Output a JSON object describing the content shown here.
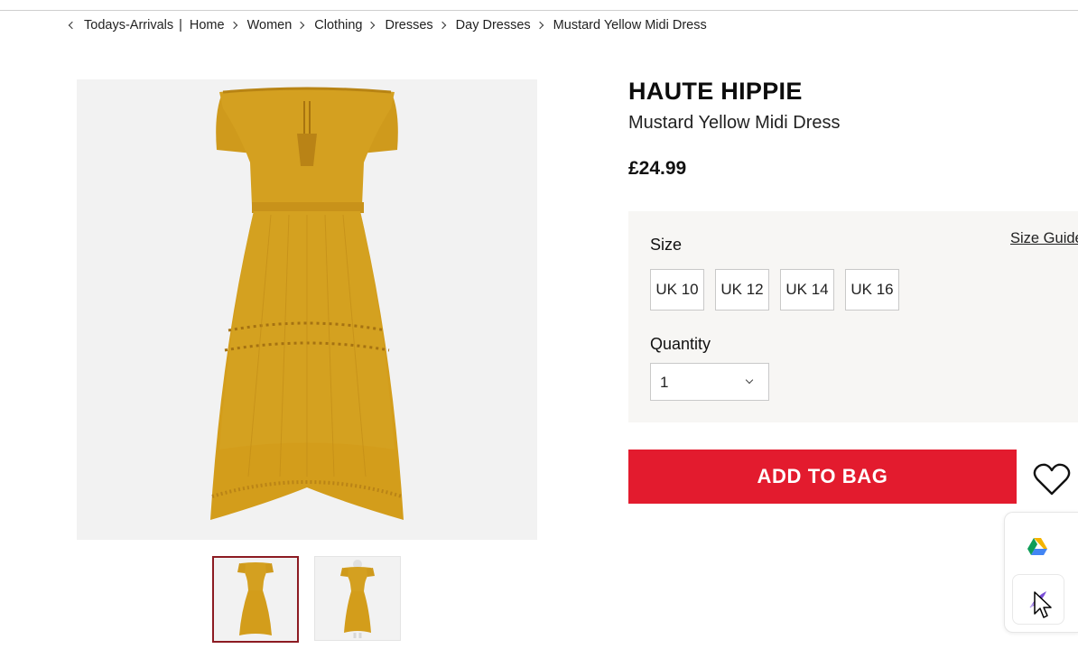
{
  "breadcrumb": {
    "back_label": "Todays-Arrivals",
    "items": [
      "Home",
      "Women",
      "Clothing",
      "Dresses",
      "Day Dresses",
      "Mustard Yellow Midi Dress"
    ]
  },
  "product": {
    "brand": "HAUTE HIPPIE",
    "name": "Mustard Yellow Midi Dress",
    "price": "£24.99",
    "dress_color": "#d39d1b"
  },
  "options": {
    "size_label": "Size",
    "size_guide": "Size Guide",
    "sizes": [
      "UK 10",
      "UK 12",
      "UK 14",
      "UK 16"
    ],
    "quantity_label": "Quantity",
    "quantity_value": "1"
  },
  "actions": {
    "add_to_bag": "ADD TO BAG",
    "add_to_bag_color": "#e31b2e"
  },
  "icons": {
    "wishlist": "heart-icon",
    "extension_1": "google-drive-icon",
    "extension_2": "feather-icon"
  }
}
